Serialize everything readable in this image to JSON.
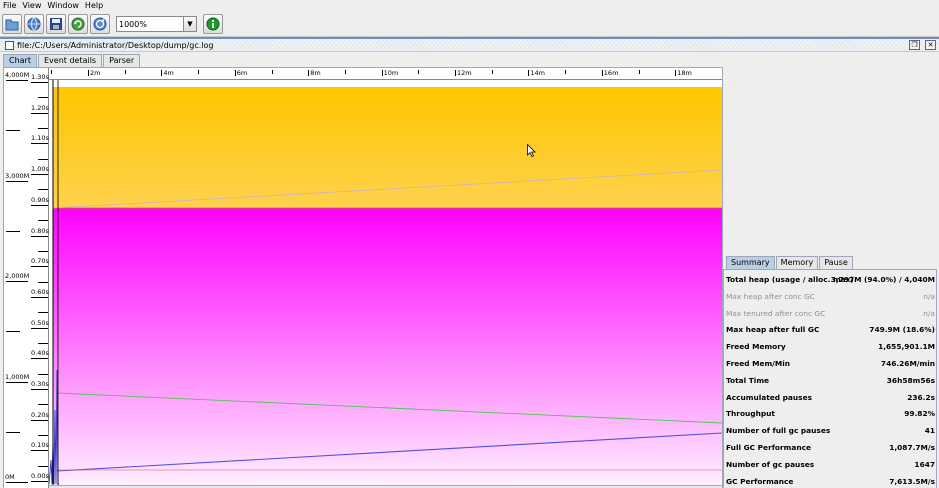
{
  "menu": [
    {
      "id": "file",
      "label": "File"
    },
    {
      "id": "view",
      "label": "View"
    },
    {
      "id": "window",
      "label": "Window"
    },
    {
      "id": "help",
      "label": "Help"
    }
  ],
  "toolbar": {
    "zoom_value": "1000%",
    "buttons": [
      {
        "name": "open-file-button",
        "icon": "open-file-icon"
      },
      {
        "name": "open-url-button",
        "icon": "globe-icon"
      },
      {
        "name": "export-button",
        "icon": "save-icon"
      },
      {
        "name": "refresh-button",
        "icon": "refresh-icon"
      },
      {
        "name": "watch-button",
        "icon": "watch-icon"
      },
      {
        "name": "about-button",
        "icon": "info-icon"
      }
    ]
  },
  "document": {
    "title": "file:/C:/Users/Administrator/Desktop/dump/gc.log",
    "tabs": [
      "Chart",
      "Event details",
      "Parser"
    ],
    "active_tab": "Chart"
  },
  "chart": {
    "time_ticks": [
      "2m",
      "4m",
      "6m",
      "8m",
      "10m",
      "12m",
      "14m",
      "16m",
      "18m"
    ],
    "pause_ticks": [
      "1.30s",
      "1.20s",
      "1.10s",
      "1.00s",
      "0.90s",
      "0.80s",
      "0.70s",
      "0.60s",
      "0.50s",
      "0.40s",
      "0.30s",
      "0.20s",
      "0.10s",
      "0.00s"
    ],
    "memory_ticks": [
      "4,000M",
      "3,000M",
      "2,000M",
      "1,000M",
      "0M"
    ],
    "colors": {
      "total_heap_top": "#ffc600",
      "total_heap_bottom": "#ffd24d",
      "used_heap_top": "#ff00ff",
      "used_heap_bottom": "#fff0ff",
      "tenured_line": "#58c058",
      "young_line": "#5050e0",
      "pause_line": "#3030c0"
    }
  },
  "summary": {
    "tabs": [
      "Summary",
      "Memory",
      "Pause"
    ],
    "active_tab": "Summary",
    "rows": [
      {
        "label": "Total heap (usage / alloc. max)",
        "value": "3,797M (94.0%) / 4,040M",
        "dim": false
      },
      {
        "label": "Max heap after conc GC",
        "value": "n/a",
        "dim": true
      },
      {
        "label": "Max tenured after conc GC",
        "value": "n/a",
        "dim": true
      },
      {
        "label": "Max heap after full GC",
        "value": "749.9M (18.6%)",
        "dim": false
      },
      {
        "label": "Freed Memory",
        "value": "1,655,901.1M",
        "dim": false
      },
      {
        "label": "Freed Mem/Min",
        "value": "746.26M/min",
        "dim": false
      },
      {
        "label": "Total Time",
        "value": "36h58m56s",
        "dim": false
      },
      {
        "label": "Accumulated pauses",
        "value": "236.2s",
        "dim": false
      },
      {
        "label": "Throughput",
        "value": "99.82%",
        "dim": false
      },
      {
        "label": "Number of full gc pauses",
        "value": "41",
        "dim": false
      },
      {
        "label": "Full GC Performance",
        "value": "1,087.7M/s",
        "dim": false
      },
      {
        "label": "Number of gc pauses",
        "value": "1647",
        "dim": false
      },
      {
        "label": "GC Performance",
        "value": "7,613.5M/s",
        "dim": false
      }
    ]
  }
}
